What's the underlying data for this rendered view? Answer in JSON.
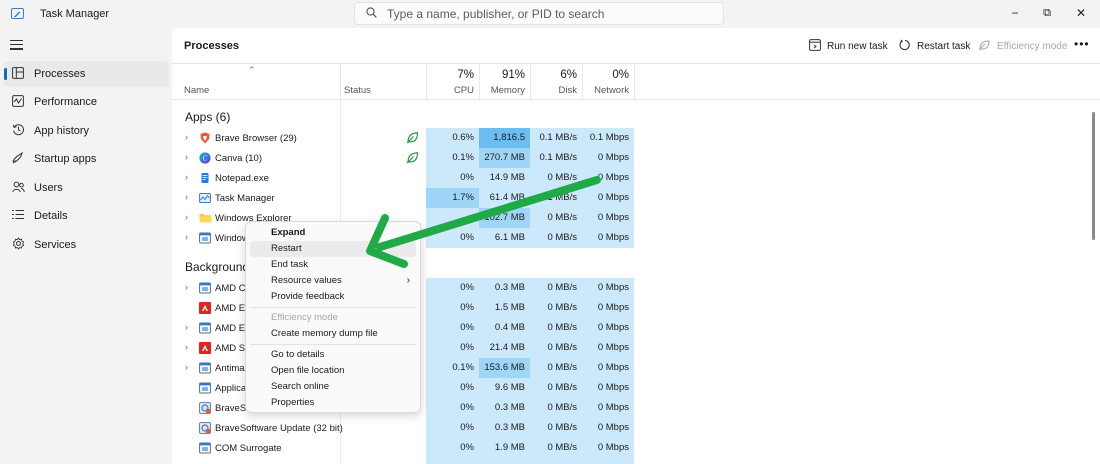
{
  "window": {
    "title": "Task Manager",
    "search_placeholder": "Type a name, publisher, or PID to search",
    "minimize": "−",
    "maximize": "⧉",
    "close": "✕"
  },
  "sidebar": {
    "items": [
      {
        "label": "Processes",
        "icon": "processes-icon"
      },
      {
        "label": "Performance",
        "icon": "performance-icon"
      },
      {
        "label": "App history",
        "icon": "app-history-icon"
      },
      {
        "label": "Startup apps",
        "icon": "startup-apps-icon"
      },
      {
        "label": "Users",
        "icon": "users-icon"
      },
      {
        "label": "Details",
        "icon": "details-icon"
      },
      {
        "label": "Services",
        "icon": "services-icon"
      }
    ]
  },
  "toolbar": {
    "title": "Processes",
    "run_new_task": "Run new task",
    "restart_task": "Restart task",
    "efficiency_mode": "Efficiency mode",
    "more": "•••"
  },
  "columns": {
    "name": "Name",
    "status": "Status",
    "cpu_pct": "7%",
    "cpu": "CPU",
    "memory_pct": "91%",
    "memory": "Memory",
    "disk_pct": "6%",
    "disk": "Disk",
    "network_pct": "0%",
    "network": "Network"
  },
  "groups": {
    "apps": "Apps (6)",
    "background": "Background"
  },
  "apps": [
    {
      "name": "Brave Browser (29)",
      "icon": "brave-icon",
      "efficiency": true,
      "cpu": "0.6%",
      "mem": "1,816.5 MB",
      "disk": "0.1 MB/s",
      "net": "0.1 Mbps"
    },
    {
      "name": "Canva (10)",
      "icon": "canva-icon",
      "efficiency": true,
      "cpu": "0.1%",
      "mem": "270.7 MB",
      "disk": "0.1 MB/s",
      "net": "0 Mbps"
    },
    {
      "name": "Notepad.exe",
      "icon": "notepad-icon",
      "efficiency": false,
      "cpu": "0%",
      "mem": "14.9 MB",
      "disk": "0 MB/s",
      "net": "0 Mbps"
    },
    {
      "name": "Task Manager",
      "icon": "task-manager-icon",
      "efficiency": false,
      "cpu": "1.7%",
      "mem": "61.4 MB",
      "disk": "0.1 MB/s",
      "net": "0 Mbps"
    },
    {
      "name": "Windows Explorer",
      "icon": "folder-icon",
      "efficiency": false,
      "cpu": "",
      "mem": "102.7 MB",
      "disk": "0 MB/s",
      "net": "0 Mbps"
    },
    {
      "name": "Window",
      "icon": "window-icon",
      "efficiency": false,
      "cpu": "0%",
      "mem": "6.1 MB",
      "disk": "0 MB/s",
      "net": "0 Mbps"
    }
  ],
  "background": [
    {
      "name": "AMD Cr",
      "icon": "window-icon",
      "expand": true,
      "cpu": "0%",
      "mem": "0.3 MB",
      "disk": "0 MB/s",
      "net": "0 Mbps"
    },
    {
      "name": "AMD Ex",
      "icon": "amd-icon",
      "expand": false,
      "cpu": "0%",
      "mem": "1.5 MB",
      "disk": "0 MB/s",
      "net": "0 Mbps"
    },
    {
      "name": "AMD Ex",
      "icon": "window-icon",
      "expand": true,
      "cpu": "0%",
      "mem": "0.4 MB",
      "disk": "0 MB/s",
      "net": "0 Mbps"
    },
    {
      "name": "AMD Sc",
      "icon": "amd-icon",
      "expand": true,
      "cpu": "0%",
      "mem": "21.4 MB",
      "disk": "0 MB/s",
      "net": "0 Mbps"
    },
    {
      "name": "Antimal",
      "icon": "window-icon",
      "expand": true,
      "cpu": "0.1%",
      "mem": "153.6 MB",
      "disk": "0 MB/s",
      "net": "0 Mbps"
    },
    {
      "name": "Applica",
      "icon": "window-icon",
      "expand": false,
      "cpu": "0%",
      "mem": "9.6 MB",
      "disk": "0 MB/s",
      "net": "0 Mbps"
    },
    {
      "name": "BraveSo",
      "icon": "brave-update-icon",
      "expand": false,
      "cpu": "0%",
      "mem": "0.3 MB",
      "disk": "0 MB/s",
      "net": "0 Mbps"
    },
    {
      "name": "BraveSoftware Update (32 bit)",
      "icon": "brave-update-icon",
      "expand": false,
      "cpu": "0%",
      "mem": "0.3 MB",
      "disk": "0 MB/s",
      "net": "0 Mbps"
    },
    {
      "name": "COM Surrogate",
      "icon": "window-icon",
      "expand": false,
      "cpu": "0%",
      "mem": "1.9 MB",
      "disk": "0 MB/s",
      "net": "0 Mbps"
    }
  ],
  "context_menu": {
    "items": [
      {
        "label": "Expand",
        "bold": true
      },
      {
        "label": "Restart",
        "hover": true
      },
      {
        "label": "End task"
      },
      {
        "label": "Resource values",
        "submenu": true
      },
      {
        "label": "Provide feedback"
      },
      {
        "label": "Efficiency mode",
        "disabled": true
      },
      {
        "label": "Create memory dump file"
      },
      {
        "label": "Go to details"
      },
      {
        "label": "Open file location"
      },
      {
        "label": "Search online"
      },
      {
        "label": "Properties"
      }
    ],
    "submenu_glyph": "›"
  },
  "glyphs": {
    "expand": "›",
    "sort": "⌃"
  },
  "colors": {
    "accent": "#1667c0",
    "heat_light": "#c6e7fb",
    "heat_medium": "#9fd5f7",
    "heat_strong": "#6cbef1",
    "arrow": "#1faa45"
  }
}
